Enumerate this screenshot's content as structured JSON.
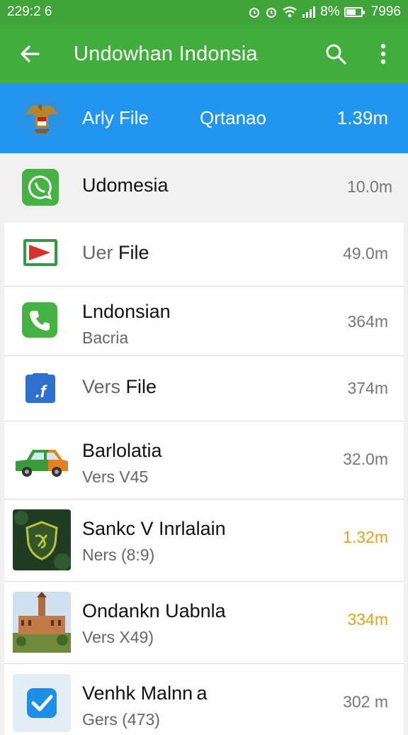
{
  "status_bar": {
    "time": "229:2 6",
    "battery_pct": "8%",
    "clock_right": "7996"
  },
  "app_bar": {
    "title": "Undowhan Indonsia"
  },
  "tabs": {
    "tab1": "Arly File",
    "tab2": "Qrtanao",
    "size": "1.39m",
    "active_tab": 2
  },
  "list": [
    {
      "name": "Udomesia",
      "size": "10.0m"
    },
    {
      "name_muted": "Uer",
      "name_bold": "File",
      "size": "49.0m"
    },
    {
      "name": "Lndonsian",
      "sub": "Bacria",
      "size": "364m"
    },
    {
      "name_muted": "Vers",
      "name_bold": "File",
      "size": "374m"
    },
    {
      "name": "Barlolatia",
      "sub": "Vers V45",
      "size": "32.0m"
    },
    {
      "name": "Sankc V Inrlalain",
      "sub": "Ners (8:9)",
      "size": "1.32m"
    },
    {
      "name": "Ondankn Uabnla",
      "sub": "Vers X49)",
      "size": "334m"
    },
    {
      "name": "Venhk Malnn a",
      "sub": "Gers (473)",
      "size": "302 m"
    }
  ],
  "colors": {
    "green": "#41ad3c",
    "blue": "#2196f0",
    "orange": "#e2a21a"
  },
  "icons": [
    "back-arrow-icon",
    "search-icon",
    "more-vert-icon",
    "garuda-emblem-icon",
    "whatsapp-icon",
    "flag-icon",
    "phone-icon",
    "facebook-icon",
    "car-icon",
    "shield-icon",
    "building-photo",
    "check-icon"
  ]
}
